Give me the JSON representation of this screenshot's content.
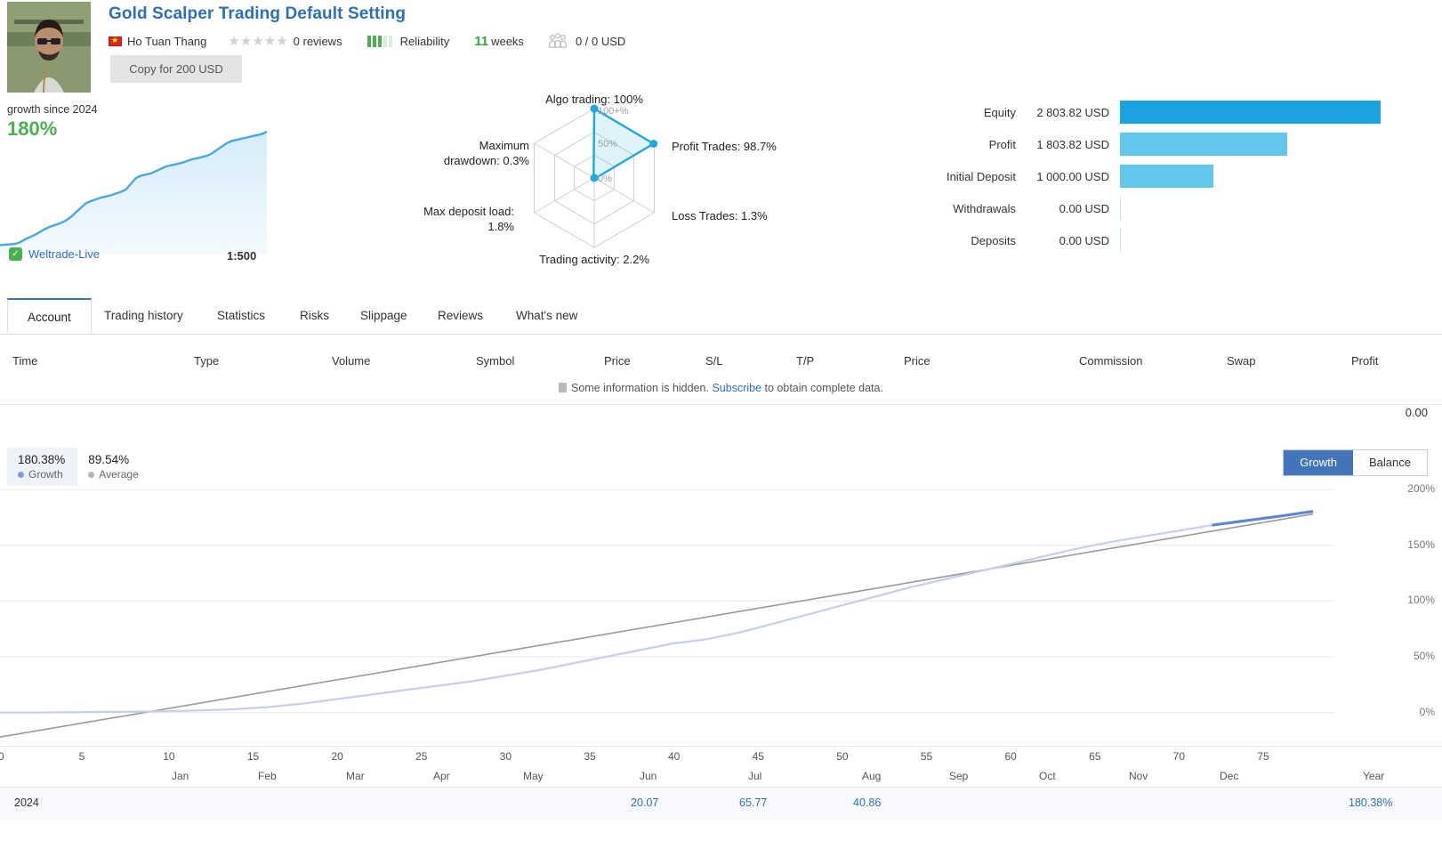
{
  "header": {
    "title": "Gold Scalper Trading Default Setting",
    "author": "Ho Tuan Thang",
    "flag_icon": "vietnam-flag",
    "reviews": "0 reviews",
    "rating_stars": 0,
    "reliability_label": "Reliability",
    "reliability_filled": 3,
    "weeks_number": "11",
    "weeks_label": "weeks",
    "subscribers": "0 / 0 USD",
    "copy_button": "Copy for 200 USD"
  },
  "growth_widget": {
    "label": "growth since 2024",
    "value": "180%",
    "broker": "Weltrade-Live",
    "leverage": "1:500",
    "spark": [
      2,
      2.4,
      2.6,
      3,
      4.5,
      7,
      9,
      11,
      13.5,
      16,
      18,
      19.5,
      21,
      23,
      26,
      30,
      34,
      38,
      40,
      41.5,
      43,
      44,
      45,
      46.5,
      48,
      50,
      55,
      60,
      62,
      63,
      64,
      66,
      68,
      70,
      71,
      72,
      73,
      74.5,
      76,
      77,
      78,
      79,
      81,
      84,
      87,
      90,
      92,
      93,
      94,
      95,
      96,
      97,
      98,
      100
    ]
  },
  "radar": {
    "type": "radar",
    "rings": [
      "0%",
      "50%",
      "100+%"
    ],
    "axes": [
      {
        "label": "Algo trading: 100%",
        "name": "Algo trading",
        "value": 100
      },
      {
        "label": "Profit Trades: 98.7%",
        "name": "Profit Trades",
        "value": 98.7
      },
      {
        "label": "Loss Trades: 1.3%",
        "name": "Loss Trades",
        "value": 1.3
      },
      {
        "label": "Trading activity: 2.2%",
        "name": "Trading activity",
        "value": 2.2
      },
      {
        "label": "Max deposit load: 1.8%",
        "name": "Max deposit load",
        "value": 1.8
      },
      {
        "label": "Maximum drawdown: 0.3%",
        "name": "Maximum drawdown",
        "value": 0.3
      }
    ],
    "accent": "#1ea7e1"
  },
  "equity": {
    "rows": [
      {
        "name": "Equity",
        "value": "2 803.82 USD",
        "pct": 100,
        "color": "#1ba3e0"
      },
      {
        "name": "Profit",
        "value": "1 803.82 USD",
        "pct": 64.3,
        "color": "#63c8ee"
      },
      {
        "name": "Initial Deposit",
        "value": "1 000.00 USD",
        "pct": 35.7,
        "color": "#63c8ee"
      },
      {
        "name": "Withdrawals",
        "value": "0.00 USD",
        "pct": 0,
        "color": "#63c8ee"
      },
      {
        "name": "Deposits",
        "value": "0.00 USD",
        "pct": 0,
        "color": "#63c8ee"
      }
    ]
  },
  "tabs": [
    {
      "label": "Account",
      "active": true
    },
    {
      "label": "Trading history",
      "active": false
    },
    {
      "label": "Statistics",
      "active": false
    },
    {
      "label": "Risks",
      "active": false
    },
    {
      "label": "Slippage",
      "active": false
    },
    {
      "label": "Reviews",
      "active": false
    },
    {
      "label": "What's new",
      "active": false
    }
  ],
  "table": {
    "columns": [
      "Time",
      "Type",
      "Volume",
      "Symbol",
      "Price",
      "S/L",
      "T/P",
      "Price",
      "Commission",
      "Swap",
      "Profit"
    ],
    "hidden_prefix": "Some information is hidden.",
    "hidden_link": "Subscribe",
    "hidden_suffix": "to obtain complete data.",
    "total": "0.00"
  },
  "legend": [
    {
      "value": "180.38%",
      "name": "Growth",
      "color": "#7d9fe0",
      "selected": true
    },
    {
      "value": "89.54%",
      "name": "Average",
      "color": "#b5b5b5",
      "selected": false
    }
  ],
  "toggle": {
    "growth": "Growth",
    "balance": "Balance",
    "selected": "Growth"
  },
  "chart_data": {
    "type": "line",
    "title": "",
    "xlabel": "",
    "ylabel": "",
    "ylim": [
      -25,
      200
    ],
    "yticks": [
      "200%",
      "150%",
      "100%",
      "50%",
      "0%"
    ],
    "ytick_values": [
      200,
      150,
      100,
      50,
      0
    ],
    "grid": true,
    "xticks": [
      "0",
      "5",
      "10",
      "15",
      "20",
      "25",
      "30",
      "35",
      "40",
      "45",
      "50",
      "55",
      "60",
      "65",
      "70",
      "75"
    ],
    "xtick_values": [
      0,
      5,
      10,
      15,
      20,
      25,
      30,
      35,
      40,
      45,
      50,
      55,
      60,
      65,
      70,
      75
    ],
    "months": [
      "Jan",
      "Feb",
      "Mar",
      "Apr",
      "May",
      "Jun",
      "Jul",
      "Aug",
      "Sep",
      "Oct",
      "Nov",
      "Dec"
    ],
    "year_col": "Year",
    "series": [
      {
        "name": "Growth",
        "color": "#c3cff0",
        "highlight_color": "#5b87d8",
        "x": [
          0,
          2,
          4,
          6,
          8,
          10,
          12,
          14,
          16,
          18,
          20,
          22,
          24,
          26,
          28,
          30,
          32,
          34,
          36,
          38,
          40,
          42,
          44,
          46,
          48,
          50,
          52,
          54,
          56,
          58,
          60,
          62,
          64,
          66,
          68,
          70,
          72,
          74,
          76,
          78
        ],
        "values": [
          0,
          0,
          0.2,
          0.5,
          0.8,
          1.2,
          2,
          3,
          5,
          8,
          12,
          16,
          20.07,
          24,
          28,
          33,
          38,
          44,
          50,
          56,
          62,
          65.77,
          72,
          80,
          88,
          96,
          104,
          112,
          119,
          126,
          133,
          140,
          147,
          153,
          158,
          163,
          168,
          172,
          176,
          180.38
        ]
      },
      {
        "name": "Average",
        "color": "#9a9a9a",
        "x": [
          0,
          78
        ],
        "values": [
          -22,
          178
        ]
      }
    ]
  },
  "year_row": {
    "year": "2024",
    "values": [
      {
        "month": "Jan",
        "value": ""
      },
      {
        "month": "Feb",
        "value": ""
      },
      {
        "month": "Mar",
        "value": ""
      },
      {
        "month": "Apr",
        "value": ""
      },
      {
        "month": "May",
        "value": ""
      },
      {
        "month": "Jun",
        "value": "20.07"
      },
      {
        "month": "Jul",
        "value": "65.77"
      },
      {
        "month": "Aug",
        "value": "40.86"
      },
      {
        "month": "Sep",
        "value": ""
      },
      {
        "month": "Oct",
        "value": ""
      },
      {
        "month": "Nov",
        "value": ""
      },
      {
        "month": "Dec",
        "value": ""
      }
    ],
    "year_total": "180.38%"
  }
}
